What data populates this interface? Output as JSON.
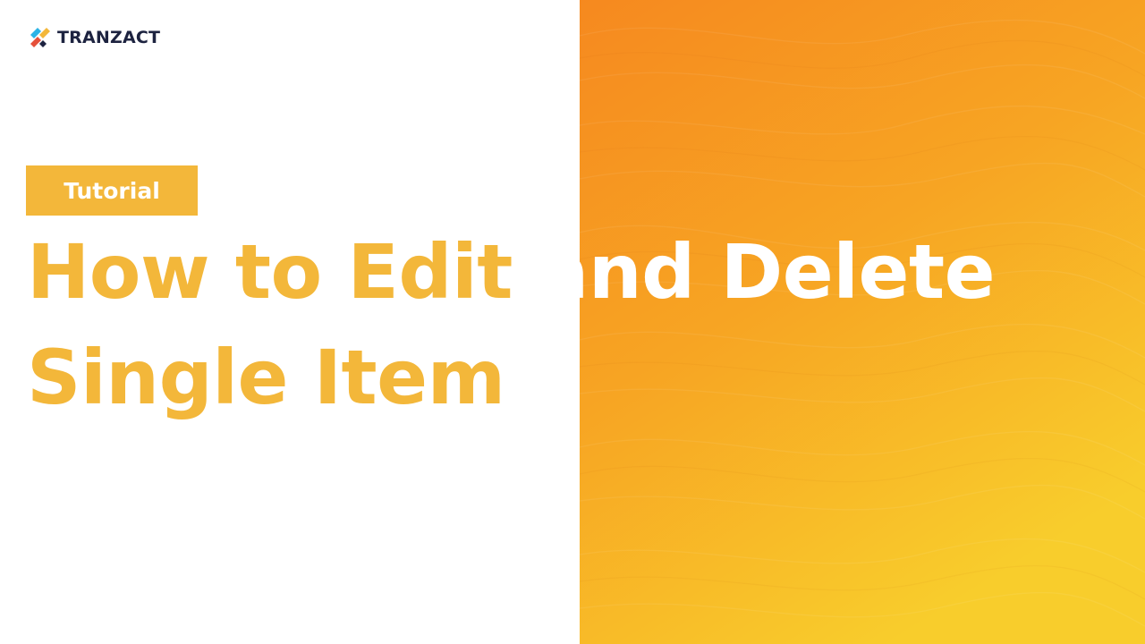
{
  "brand": {
    "name": "TRANZACT",
    "icon": "tranzact-logo-icon",
    "colors": {
      "accent": "#f3b73a",
      "gradient_top": "#f6891f",
      "gradient_bottom": "#f8cd2c"
    }
  },
  "badge": {
    "label": "Tutorial"
  },
  "headline": {
    "line1_part1": "How to Edit",
    "line1_part2": "and Delete",
    "line2": "Single Item"
  }
}
